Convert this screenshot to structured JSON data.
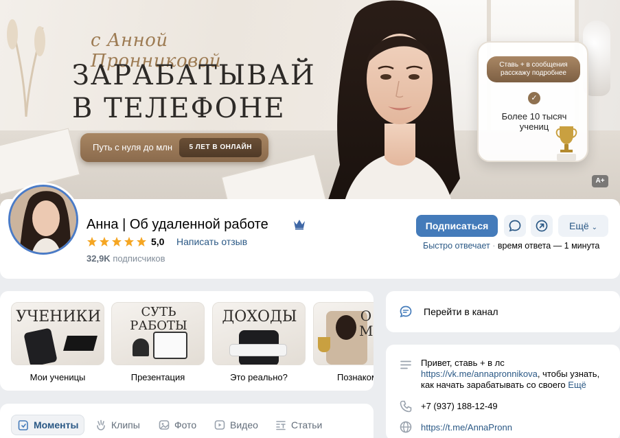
{
  "cover": {
    "script_title": "с Анной Пронниковой",
    "title_line1": "ЗАРАБАТЫВАЙ",
    "title_line2": "В ТЕЛЕФОНЕ",
    "pill_left": "Путь с нуля до млн",
    "pill_right": "5 ЛЕТ В ОНЛАЙН",
    "bubble_text": "Ставь + в сообщения расскажу подробнее",
    "stat_text": "Более 10 тысяч учениц",
    "a_plus": "A+"
  },
  "profile": {
    "name": "Анна | Об удаленной работе",
    "rating": "5,0",
    "stars": 5,
    "review_link": "Написать отзыв",
    "subscribers_count": "32,9K",
    "subscribers_label": "подписчиков",
    "subscribe_button": "Подписаться",
    "more_button": "Ещё",
    "reply_fast": "Быстро отвечает",
    "reply_dot": "·",
    "reply_time": "время ответа — 1 минута"
  },
  "services": [
    {
      "thumb_title": "УЧЕНИКИ",
      "caption": "Мои ученицы"
    },
    {
      "thumb_title": "СУТЬ РАБОТЫ",
      "caption": "Презентация"
    },
    {
      "thumb_title": "ДОХОДЫ",
      "caption": "Это реально?"
    },
    {
      "thumb_title": "О М",
      "caption": "Познакоми"
    }
  ],
  "channel": {
    "label": "Перейти в канал"
  },
  "about": {
    "text_before": "Привет, ставь + в лс ",
    "link": "https://vk.me/annapronnikova",
    "text_after": ", чтобы узнать, как начать зарабатывать со своего",
    "more": "Ещё",
    "phone": "+7 (937) 188-12-49",
    "website": "https://t.me/AnnaPronn"
  },
  "tabs": [
    {
      "label": "Моменты",
      "icon": "moments-icon",
      "active": true
    },
    {
      "label": "Клипы",
      "icon": "clips-icon"
    },
    {
      "label": "Фото",
      "icon": "photo-icon"
    },
    {
      "label": "Видео",
      "icon": "video-icon"
    },
    {
      "label": "Статьи",
      "icon": "articles-icon"
    }
  ],
  "colors": {
    "accent": "#447bba",
    "link": "#2a5885",
    "gold": "#a88663",
    "star": "#f5a623"
  }
}
